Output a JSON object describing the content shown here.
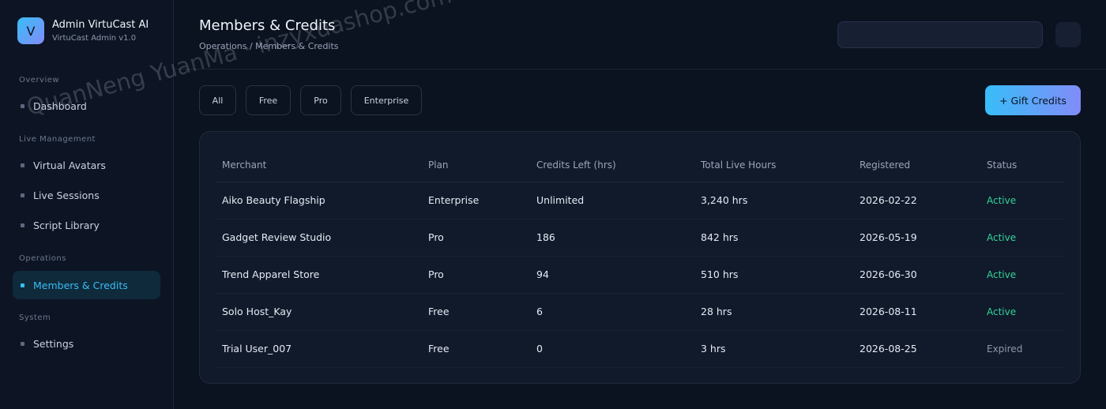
{
  "brand": {
    "logo_letter": "V",
    "title": "Admin VirtuCast AI",
    "subtitle": "VirtuCast Admin v1.0"
  },
  "sidebar": {
    "sections": [
      {
        "label": "Overview",
        "items": [
          {
            "label": "Dashboard"
          }
        ]
      },
      {
        "label": "Live Management",
        "items": [
          {
            "label": "Virtual Avatars"
          },
          {
            "label": "Live Sessions"
          },
          {
            "label": "Script Library"
          }
        ]
      },
      {
        "label": "Operations",
        "items": [
          {
            "label": "Members & Credits",
            "active": true
          }
        ]
      },
      {
        "label": "System",
        "items": [
          {
            "label": "Settings"
          }
        ]
      }
    ]
  },
  "header": {
    "title": "Members & Credits",
    "breadcrumb": "Operations / Members & Credits"
  },
  "filters": {
    "all": "All",
    "free": "Free",
    "pro": "Pro",
    "enterprise": "Enterprise"
  },
  "gift_button": "+ Gift Credits",
  "table": {
    "columns": [
      "Merchant",
      "Plan",
      "Credits Left (hrs)",
      "Total Live Hours",
      "Registered",
      "Status"
    ],
    "rows": [
      [
        "Aiko Beauty Flagship",
        "Enterprise",
        "Unlimited",
        "3,240 hrs",
        "2026-02-22",
        "Active"
      ],
      [
        "Gadget Review Studio",
        "Pro",
        "186",
        "842 hrs",
        "2026-05-19",
        "Active"
      ],
      [
        "Trend Apparel Store",
        "Pro",
        "94",
        "510 hrs",
        "2026-06-30",
        "Active"
      ],
      [
        "Solo Host_Kay",
        "Free",
        "6",
        "28 hrs",
        "2026-08-11",
        "Active"
      ],
      [
        "Trial User_007",
        "Free",
        "0",
        "3 hrs",
        "2026-08-25",
        "Expired"
      ]
    ]
  },
  "watermark": "QuanNeng YuanMa · inzyxuashop.com",
  "colors": {
    "accent": "#38bdf8",
    "accent_secondary": "#818cf8",
    "status_active": "#34d399",
    "status_expired": "#8c97aa",
    "background": "#0b1220"
  }
}
